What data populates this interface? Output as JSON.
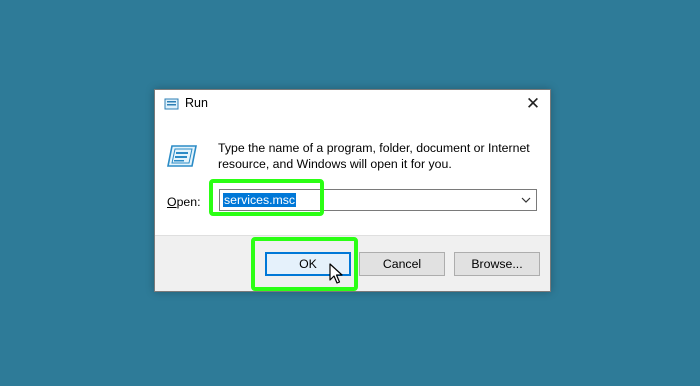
{
  "dialog": {
    "title": "Run",
    "close_glyph": "✕",
    "description": "Type the name of a program, folder, document or Internet resource, and Windows will open it for you.",
    "open_label_accel": "O",
    "open_label_rest": "pen:",
    "open_value": "services.msc",
    "buttons": {
      "ok": "OK",
      "cancel": "Cancel",
      "browse": "Browse..."
    }
  },
  "icons": {
    "title": "run-icon",
    "content": "run-icon",
    "dropdown": "chevron-down-icon",
    "cursor": "mouse-pointer-icon"
  },
  "colors": {
    "desktop": "#2e7b98",
    "highlight": "#2bff14",
    "selection": "#0078d7"
  }
}
